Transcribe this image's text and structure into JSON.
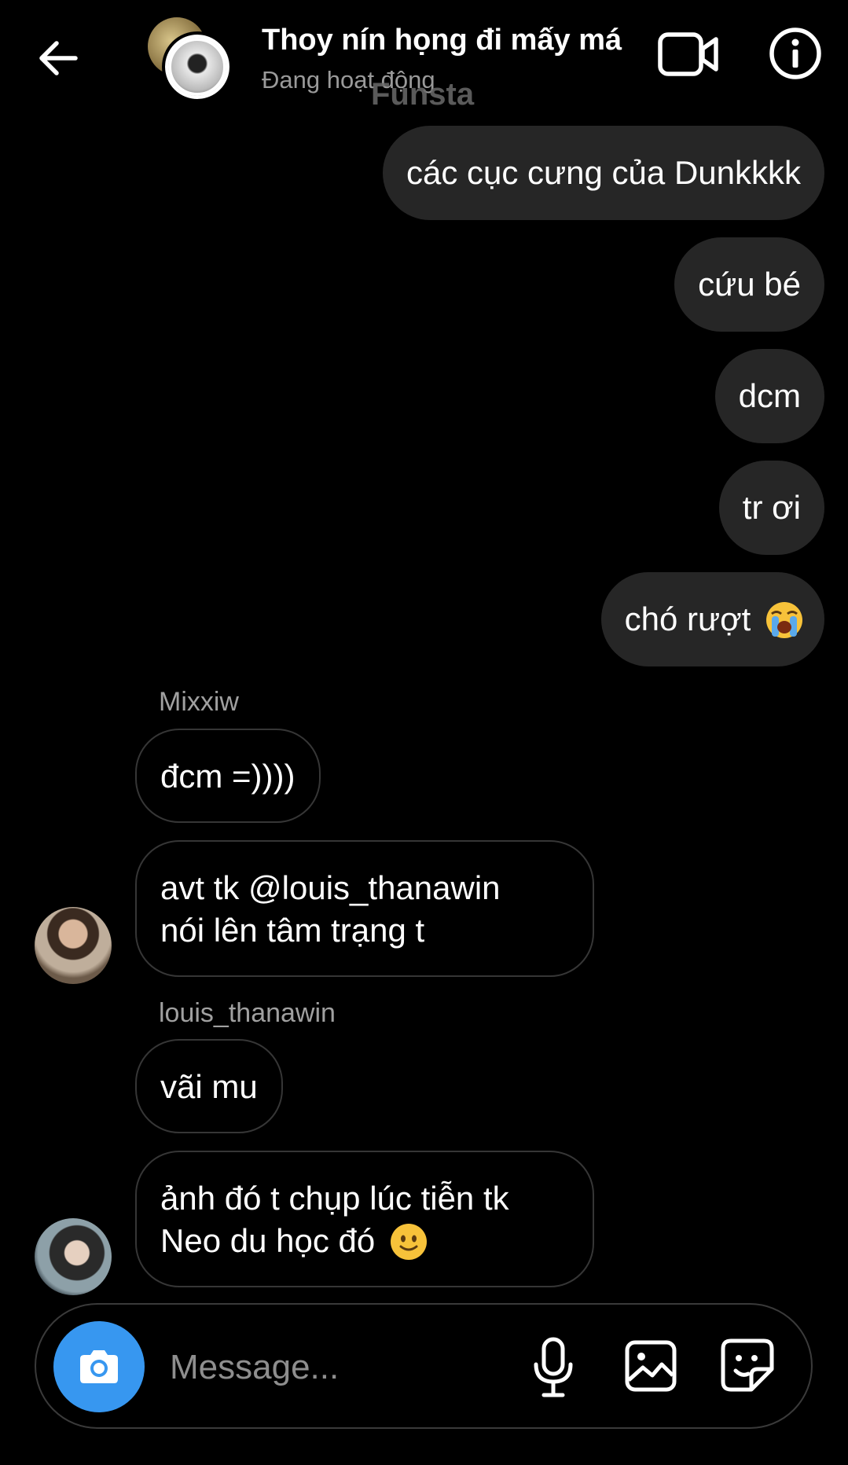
{
  "header": {
    "title": "Thoy nín họng đi mấy má",
    "status": "Đang hoạt động",
    "watermark": "Funsta"
  },
  "messages": {
    "outgoing": [
      {
        "text": "các cục cưng của Dunkkkk"
      },
      {
        "text": "cứu bé"
      },
      {
        "text": "dcm"
      },
      {
        "text": "tr ơi"
      },
      {
        "text": "chó rượt",
        "emoji": "crying-face"
      }
    ],
    "incoming": [
      {
        "sender": "Mixxiw",
        "text": "đcm =))))"
      },
      {
        "line1": "avt tk @louis_thanawin",
        "line2": "nói lên tâm trạng t"
      },
      {
        "sender": "louis_thanawin",
        "text": "vãi mu"
      },
      {
        "line1": "ảnh đó t chụp lúc tiễn tk",
        "line2": "Neo du học đó",
        "emoji": "slightly-smiling-face"
      }
    ]
  },
  "composer": {
    "placeholder": "Message..."
  },
  "colors": {
    "background": "#000000",
    "outgoing_bubble": "#262626",
    "incoming_border": "#363636",
    "camera_button": "#3797f0",
    "secondary_text": "#9a9a9a"
  },
  "icons": [
    "back-arrow-icon",
    "video-call-icon",
    "info-icon",
    "camera-icon",
    "microphone-icon",
    "gallery-icon",
    "sticker-icon"
  ]
}
